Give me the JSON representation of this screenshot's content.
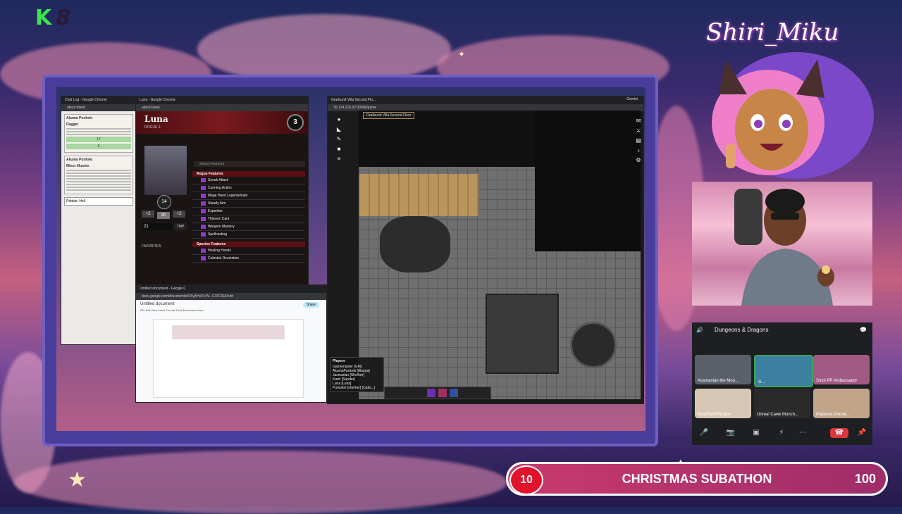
{
  "overlay": {
    "logo_k": "K",
    "logo_n": "8",
    "brand_name": "Shiri_Miku"
  },
  "chat_window": {
    "title": "Chat Log - Google Chrome",
    "address": "about:blank",
    "cards": [
      {
        "name": "Akuma Punkski",
        "item": "Dagger",
        "stat_attack": "17",
        "stat_damage": "6"
      },
      {
        "name": "Akuma Punkski",
        "item": "Minor Illusion",
        "footer": "Pebble: Hell"
      }
    ]
  },
  "sheet_window": {
    "title": "Luna - Google Chrome",
    "address": "about:blank",
    "char_name": "Luna",
    "char_class": "ROGUE 3",
    "level": "3",
    "proficiency": "+2",
    "hp": "14",
    "ac": "30",
    "init": "+2",
    "hit_dice": "21",
    "temp_hp": "TMP",
    "search_placeholder": "Search features",
    "favorites_label": "FAVORITES",
    "rogue_section": "Rogue Features",
    "rogue_features": [
      "Sneak Attack",
      "Cunning Action",
      "Mage Hand Legerdemain",
      "Steady Aim",
      "Expertise",
      "Thieves' Cant",
      "Weapon Mastery",
      "Spellcasting"
    ],
    "species_section": "Species Features",
    "species_features": [
      "Healing Hands",
      "Celestial Revelation"
    ]
  },
  "docs_window": {
    "title": "Untitled document - Google C",
    "address": "docs.google.com/document/d/1hyAHxFt-9V...CXICSUI/edit",
    "doc_title": "Untitled document",
    "menu": [
      "File",
      "Edit",
      "View",
      "Insert",
      "Format",
      "Tools",
      "Extensions",
      "Help"
    ],
    "share": "Share"
  },
  "map_window": {
    "tab": "Grailsund Villa Second Flo...",
    "address": "76.174.216.92:30000/game",
    "scene_name": "Grailsund Villa Second Floor",
    "players_label": "Players",
    "players": [
      "Gamemaster [GM]",
      "AkumaPunkski [Akuma]",
      "Jasmarian [She/her]",
      "Kami [Sander]",
      "Luna [Luna]",
      "Pumpkin [she/her] [Catlo...]"
    ],
    "gemini": "Gemini"
  },
  "discord": {
    "channel": "Dungeons & Dragons",
    "participants": [
      "Assmanian the Moo...",
      "G...",
      "Smol PP Ambassador",
      "SourPatchPumpy",
      "Unreal Cawk Munch...",
      "Madame-Doone..."
    ]
  },
  "subathon": {
    "current": "10",
    "title": "CHRISTMAS SUBATHON",
    "goal": "100"
  },
  "colors": {
    "accent_green": "#3ee34e",
    "subathon_red": "#e0132b",
    "sheet_red": "#7a1a1e"
  }
}
